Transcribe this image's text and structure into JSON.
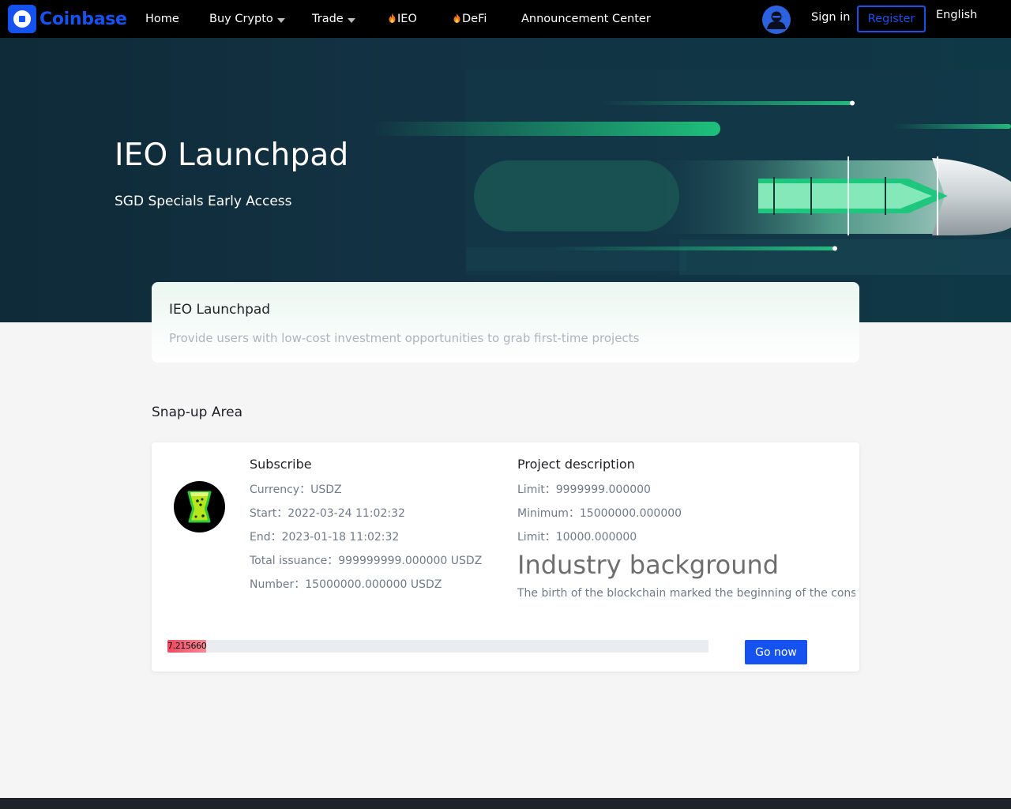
{
  "brand": {
    "name": "Coinbase",
    "color": "#1652f0"
  },
  "nav": {
    "home": "Home",
    "buy_crypto": "Buy Crypto",
    "trade": "Trade",
    "ieo": "IEO",
    "defi": "DeFi",
    "announcements": "Announcement Center",
    "sign_in": "Sign in",
    "register": "Register",
    "language": "English"
  },
  "hero": {
    "title": "IEO Launchpad",
    "subtitle": "SGD Specials Early Access"
  },
  "intro": {
    "title": "IEO Launchpad",
    "description": "Provide users with low-cost investment opportunities to grab first-time projects"
  },
  "section": {
    "title": "Snap-up Area"
  },
  "project": {
    "subscribe": {
      "title": "Subscribe",
      "currency_label": "Currency",
      "currency": "USDZ",
      "start_label": "Start",
      "start": "2022-03-24 11:02:32",
      "end_label": "End",
      "end": "2023-01-18 11:02:32",
      "total_label": "Total issuance",
      "total": "999999999.000000 USDZ",
      "number_label": "Number",
      "number": "15000000.000000 USDZ"
    },
    "description": {
      "title": "Project description",
      "limit_label": "Limit",
      "limit": "9999999.000000",
      "minimum_label": "Minimum",
      "minimum": "15000000.000000",
      "limit2_label": "Limit",
      "limit2": "10000.000000"
    },
    "industry": {
      "heading": "Industry background",
      "text": "The birth of the blockchain marked the beginning of the construction of"
    },
    "progress": {
      "label": "7.215660",
      "percent": 7.21566
    },
    "go_button": "Go now",
    "icons": {
      "token": "beer-glass-icon"
    }
  },
  "colors": {
    "accent": "#1652f0",
    "progress": "#f0475e",
    "hero_green": "#1fc77e"
  }
}
